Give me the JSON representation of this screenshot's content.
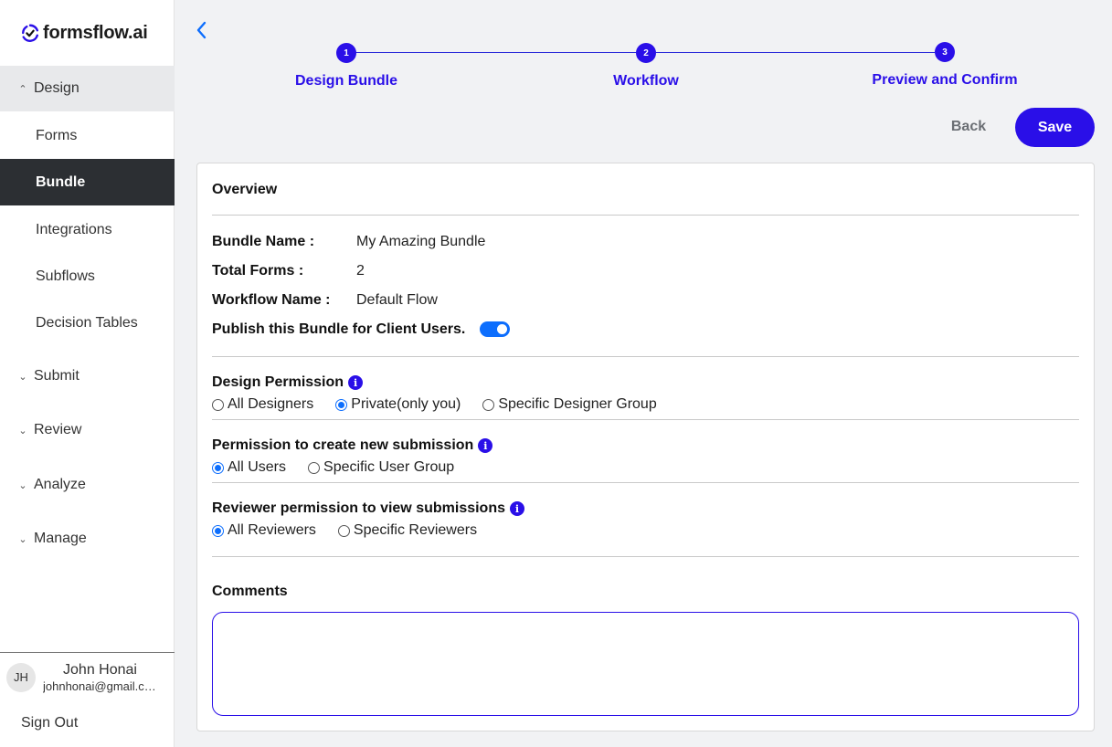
{
  "app": {
    "logo_text": "formsflow.ai"
  },
  "sidebar": {
    "design_label": "Design",
    "design_items": [
      {
        "label": "Forms"
      },
      {
        "label": "Bundle"
      },
      {
        "label": "Integrations"
      },
      {
        "label": "Subflows"
      },
      {
        "label": "Decision Tables"
      }
    ],
    "sections": [
      {
        "label": "Submit"
      },
      {
        "label": "Review"
      },
      {
        "label": "Analyze"
      },
      {
        "label": "Manage"
      }
    ],
    "user": {
      "initials": "JH",
      "name": "John Honai",
      "email": "johnhonai@gmail.com"
    },
    "sign_out": "Sign Out"
  },
  "stepper": {
    "steps": [
      {
        "number": "1",
        "label": "Design Bundle"
      },
      {
        "number": "2",
        "label": "Workflow"
      },
      {
        "number": "3",
        "label": "Preview and Confirm"
      }
    ]
  },
  "actions": {
    "back": "Back",
    "save": "Save"
  },
  "overview": {
    "title": "Overview",
    "bundle_name_label": "Bundle Name :",
    "bundle_name": "My Amazing Bundle",
    "total_forms_label": "Total Forms :",
    "total_forms": "2",
    "workflow_name_label": "Workflow Name :",
    "workflow_name": "Default Flow",
    "publish_label": "Publish this Bundle for Client Users.",
    "publish_enabled": true
  },
  "permissions": {
    "design": {
      "title": "Design Permission",
      "options": [
        "All Designers",
        "Private(only you)",
        "Specific Designer Group"
      ],
      "selected": "Private(only you)"
    },
    "submission": {
      "title": "Permission to create new submission",
      "options": [
        "All Users",
        "Specific User Group"
      ],
      "selected": "All Users"
    },
    "reviewer": {
      "title": "Reviewer permission to view submissions",
      "options": [
        "All Reviewers",
        "Specific Reviewers"
      ],
      "selected": "All Reviewers"
    }
  },
  "comments": {
    "label": "Comments",
    "value": ""
  },
  "colors": {
    "primary": "#2a0fe8",
    "toggle": "#0d6efd",
    "active_nav": "#2c2f33"
  }
}
